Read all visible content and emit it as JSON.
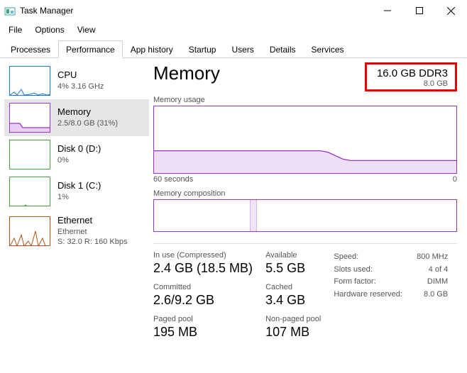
{
  "window": {
    "title": "Task Manager"
  },
  "menu": {
    "file": "File",
    "options": "Options",
    "view": "View"
  },
  "tabs": {
    "processes": "Processes",
    "performance": "Performance",
    "app_history": "App history",
    "startup": "Startup",
    "users": "Users",
    "details": "Details",
    "services": "Services"
  },
  "sidebar": {
    "cpu": {
      "title": "CPU",
      "sub": "4%  3.16 GHz"
    },
    "memory": {
      "title": "Memory",
      "sub": "2.5/8.0 GB (31%)"
    },
    "disk0": {
      "title": "Disk 0 (D:)",
      "sub": "0%"
    },
    "disk1": {
      "title": "Disk 1 (C:)",
      "sub": "1%"
    },
    "ethernet": {
      "title": "Ethernet",
      "sub1": "Ethernet",
      "sub2": "S: 32.0  R: 160 Kbps"
    }
  },
  "header": {
    "title": "Memory",
    "installed": "16.0 GB DDR3",
    "usable": "8.0 GB"
  },
  "usage": {
    "label": "Memory usage",
    "axis_left": "60 seconds",
    "axis_right": "0"
  },
  "composition": {
    "label": "Memory composition"
  },
  "stats": {
    "inuse_label": "In use (Compressed)",
    "inuse_value": "2.4 GB (18.5 MB)",
    "available_label": "Available",
    "available_value": "5.5 GB",
    "committed_label": "Committed",
    "committed_value": "2.6/9.2 GB",
    "cached_label": "Cached",
    "cached_value": "3.4 GB",
    "paged_label": "Paged pool",
    "paged_value": "195 MB",
    "nonpaged_label": "Non-paged pool",
    "nonpaged_value": "107 MB"
  },
  "kv": {
    "speed_label": "Speed:",
    "speed_value": "800 MHz",
    "slots_label": "Slots used:",
    "slots_value": "4 of 4",
    "form_label": "Form factor:",
    "form_value": "DIMM",
    "reserved_label": "Hardware reserved:",
    "reserved_value": "8.0 GB"
  },
  "colors": {
    "cpu": "#1a78d6",
    "memory": "#9933cc",
    "disk": "#3fa535",
    "ethernet": "#b0541a"
  },
  "chart_data": {
    "type": "line",
    "title": "Memory usage",
    "xlabel": "60 seconds",
    "ylabel": "",
    "ylim": [
      0,
      8.0
    ],
    "x_seconds_ago": [
      60,
      56,
      52,
      48,
      44,
      40,
      36,
      32,
      28,
      24,
      20,
      16,
      12,
      8,
      4,
      0
    ],
    "values_gb": [
      2.6,
      2.6,
      2.6,
      2.6,
      2.6,
      2.6,
      2.6,
      2.6,
      2.6,
      2.5,
      2.0,
      1.7,
      1.6,
      1.6,
      1.6,
      1.6
    ]
  }
}
